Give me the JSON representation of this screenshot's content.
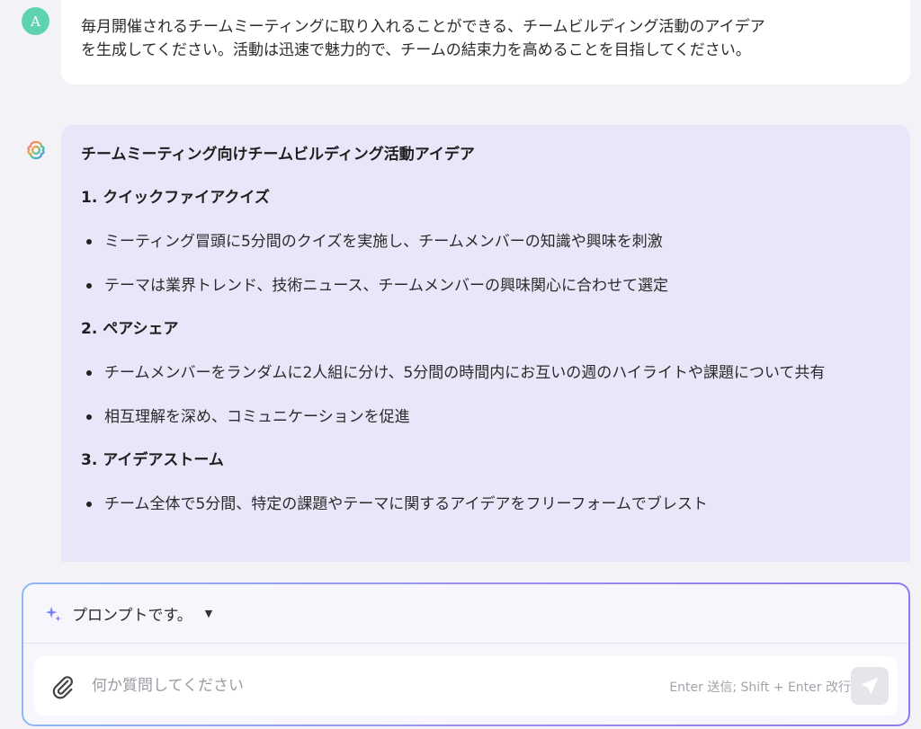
{
  "user": {
    "avatar_letter": "A",
    "message_line1": "毎月開催されるチームミーティングに取り入れることができる、チームビルディング活動のアイデア",
    "message_line2": "を生成してください。活動は迅速で魅力的で、チームの結束力を高めることを目指してください。"
  },
  "assistant": {
    "title": "チームミーティング向けチームビルディング活動アイデア",
    "sections": [
      {
        "title": "1. クイックファイアクイズ",
        "bullets": [
          "ミーティング冒頭に5分間のクイズを実施し、チームメンバーの知識や興味を刺激",
          "テーマは業界トレンド、技術ニュース、チームメンバーの興味関心に合わせて選定"
        ]
      },
      {
        "title": "2. ペアシェア",
        "bullets": [
          "チームメンバーをランダムに2人組に分け、5分間の時間内にお互いの週のハイライトや課題について共有",
          "相互理解を深め、コミュニケーションを促進"
        ]
      },
      {
        "title": "3. アイデアストーム",
        "bullets": [
          "チーム全体で5分間、特定の課題やテーマに関するアイデアをフリーフォームでブレスト"
        ]
      }
    ]
  },
  "composer": {
    "prompt_label": "プロンプトです。",
    "input_placeholder": "何か質問してください",
    "hint": "Enter 送信; Shift + Enter 改行"
  },
  "icons": {
    "ai_logo": "ai-logo-icon",
    "sparkle": "sparkle-icon",
    "dropdown": "caret-down-icon",
    "attach": "paperclip-icon",
    "send": "send-icon"
  },
  "colors": {
    "user_avatar": "#5fd3b0",
    "assistant_bubble": "#e8e6f8",
    "composer_border": "#9b8ff2"
  }
}
